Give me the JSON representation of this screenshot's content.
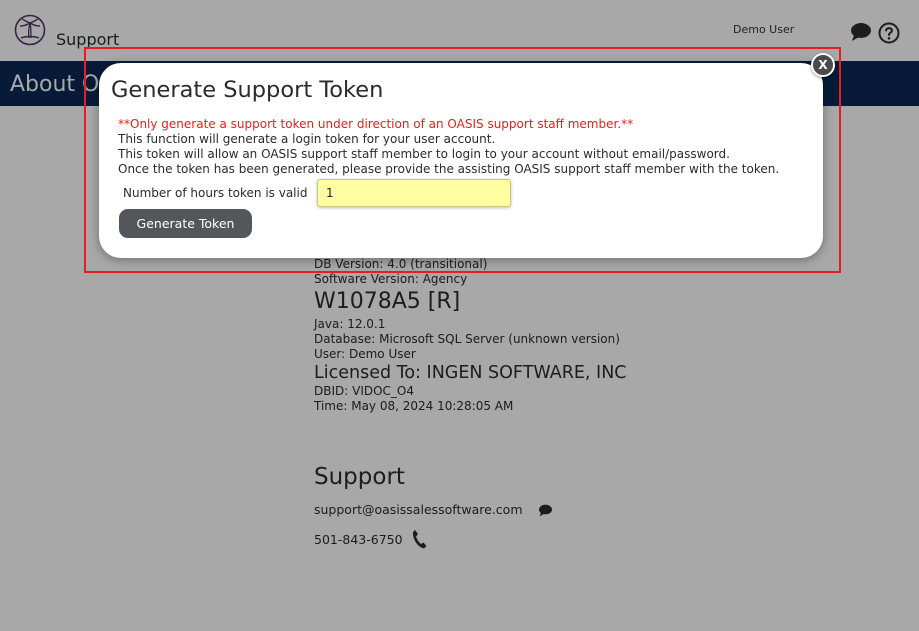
{
  "header": {
    "app_title": "Support",
    "user_name": "Demo User",
    "logo_icon": "palm-tree-logo-icon",
    "chat_icon": "chat-bubble-icon",
    "help_icon": "question-circle-icon"
  },
  "page": {
    "heading": "About OASIS"
  },
  "about": {
    "db_version": "DB Version: 4.0 (transitional)",
    "software_version": "Software Version: Agency",
    "build": "W1078A5 [R]",
    "java": "Java: 12.0.1",
    "database": "Database: Microsoft SQL Server (unknown version)",
    "user": "User: Demo User",
    "licensed_to": "Licensed To: INGEN SOFTWARE, INC",
    "dbid": "DBID: VIDOC_O4",
    "time": "Time: May 08, 2024 10:28:05 AM"
  },
  "support": {
    "title": "Support",
    "email": "support@oasissalessoftware.com",
    "phone": "501-843-6750",
    "email_icon": "chat-bubble-icon",
    "phone_icon": "phone-icon"
  },
  "modal": {
    "title": "Generate Support Token",
    "warning": "**Only generate a support token under direction of an OASIS support staff member.**",
    "info_lines": [
      "This function will generate a login token for your user account.",
      "This token will allow an OASIS support staff member to login to your account without email/password.",
      "Once the token has been generated, please provide the assisting OASIS support staff member with the token."
    ],
    "hours_label": "Number of hours token is valid",
    "hours_value": "1",
    "generate_button": "Generate Token",
    "close_label": "X"
  },
  "colors": {
    "nav_band": "#0c2a55",
    "warning_text": "#e2231a",
    "highlight_border": "#e31e24",
    "input_bg": "#fefea0",
    "button_bg": "#53565b"
  }
}
